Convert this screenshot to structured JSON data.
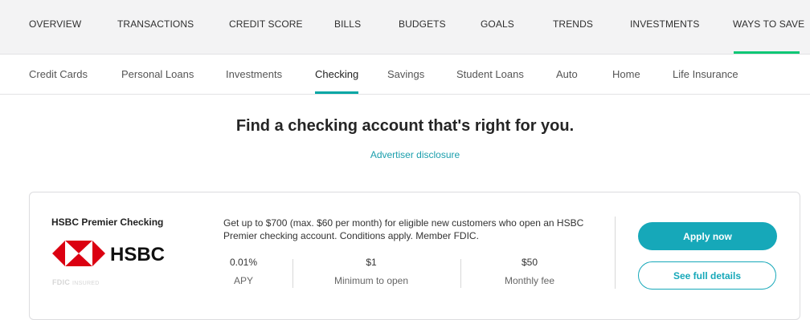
{
  "top_nav": {
    "items": [
      "OVERVIEW",
      "TRANSACTIONS",
      "CREDIT SCORE",
      "BILLS",
      "BUDGETS",
      "GOALS",
      "TRENDS",
      "INVESTMENTS",
      "WAYS TO SAVE"
    ],
    "active": "WAYS TO SAVE",
    "active_color": "#0ac775"
  },
  "sub_nav": {
    "items": [
      "Credit Cards",
      "Personal Loans",
      "Investments",
      "Checking",
      "Savings",
      "Student Loans",
      "Auto",
      "Home",
      "Life Insurance"
    ],
    "active": "Checking",
    "active_color": "#00a6a4"
  },
  "main": {
    "headline": "Find a checking account that's right for you.",
    "disclosure": "Advertiser disclosure"
  },
  "offer": {
    "account_name": "HSBC Premier Checking",
    "logo_text": "HSBC",
    "fdic_text": "FDIC",
    "fdic_sub": "INSURED",
    "description": "Get up to $700 (max. $60 per month) for eligible new customers who open an HSBC Premier checking account. Conditions apply. Member FDIC.",
    "stats": [
      {
        "value": "0.01%",
        "label": "APY"
      },
      {
        "value": "$1",
        "label": "Minimum to open"
      },
      {
        "value": "$50",
        "label": "Monthly fee"
      }
    ],
    "apply_label": "Apply now",
    "details_label": "See full details",
    "button_color": "#16a8b9",
    "logo_color": "#db0011"
  }
}
